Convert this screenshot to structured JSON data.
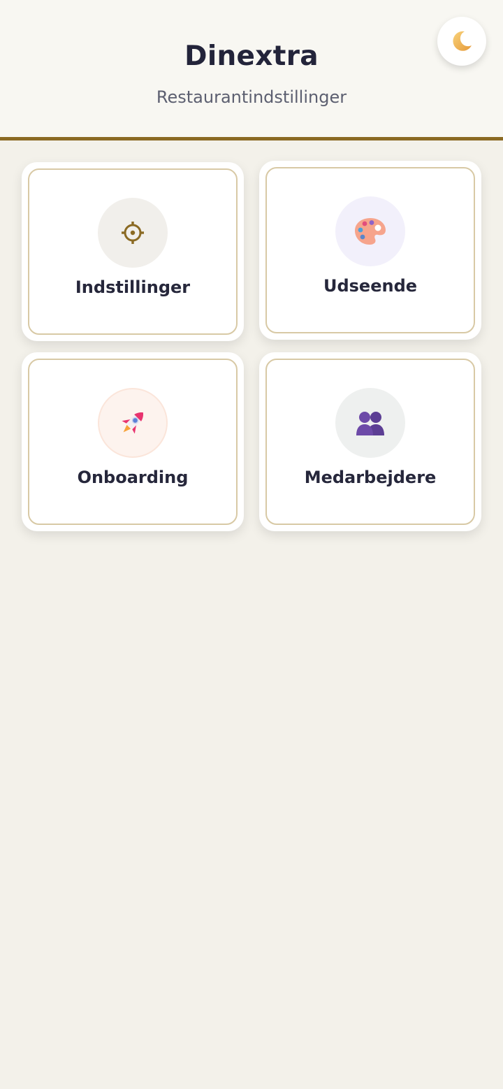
{
  "header": {
    "title": "Dinextra",
    "subtitle": "Restaurantindstillinger"
  },
  "theme_toggle": {
    "icon": "moon-icon"
  },
  "tiles": [
    {
      "label": "Indstillinger",
      "icon": "gear-icon"
    },
    {
      "label": "Udseende",
      "icon": "palette-icon"
    },
    {
      "label": "Onboarding",
      "icon": "rocket-icon"
    },
    {
      "label": "Medarbejdere",
      "icon": "people-icon"
    }
  ],
  "colors": {
    "accent": "#8b6a23",
    "background": "#f3f1ea",
    "header_background": "#f8f7f2",
    "tile_border": "#d8c9a5",
    "text": "#26273b"
  }
}
